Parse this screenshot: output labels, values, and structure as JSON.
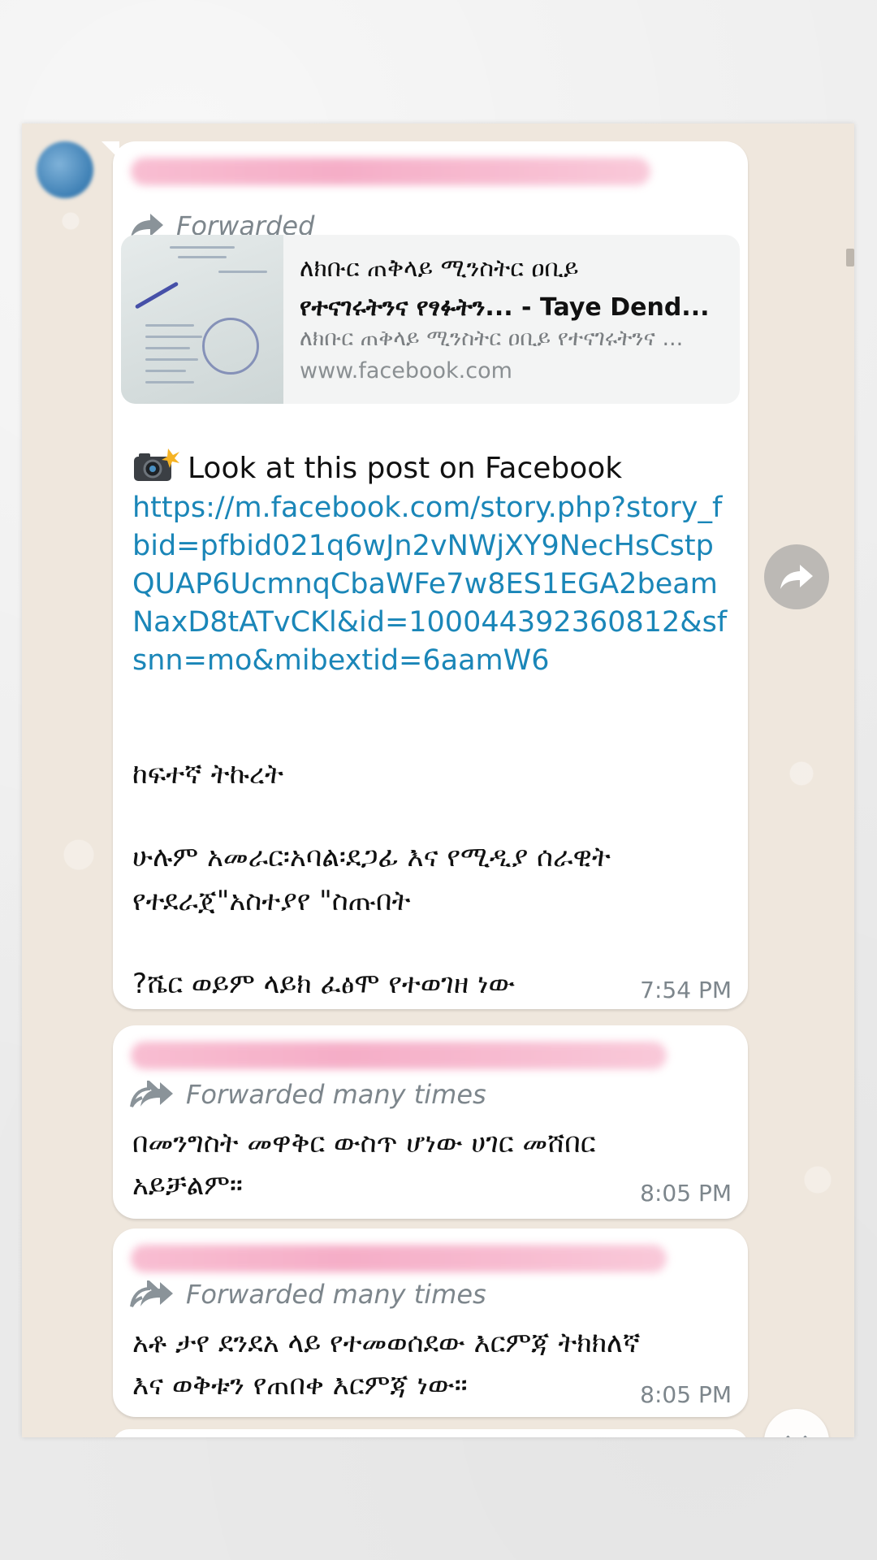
{
  "chat": {
    "messages": [
      {
        "forward_label": "Forwarded",
        "link_preview": {
          "title_line1": "ለክቡር ጠቅላይ ሚንስትር ዐቢይ",
          "title_line2": "የተናገሩትንና የፃፉትን... - Taye Dend...",
          "description": "ለክቡር ጠቅላይ ሚንስትር ዐቢይ የተናገሩትንና ...",
          "domain": "www.facebook.com"
        },
        "intro_text": "Look at this post on Facebook",
        "link_text": "https://m.facebook.com/story.php?story_fbid=pfbid021q6wJn2vNWjXY9NecHsCstpQUAP6UcmnqCbaWFe7w8ES1EGA2beamNaxD8tATvCKl&id=100044392360812&sfsnn=mo&mibextid=6aamW6",
        "line_a": "ከፍተኛ ትኩረት",
        "line_b1": "ሁሉም አመራር፡አባል፡ደጋፊ እና የሚዲያ ሰራዊት",
        "line_b2": "የተደራጀ\"አስተያየ \"ስጡበት",
        "line_c": "?ሼር ወይም ላይክ ፈፅሞ የተወገዘ ነው",
        "time": "7:54 PM"
      },
      {
        "forward_label": "Forwarded many times",
        "text_line1": "በመንግስት መዋቅር ውስጥ ሆነው ሀገር መሸበር",
        "text_line2": "አይቻልም።",
        "time": "8:05 PM"
      },
      {
        "forward_label": "Forwarded many times",
        "text_line1": "አቶ ታየ ደንደአ ላይ የተመወሰደው እርምጃ ትክክለኛ",
        "text_line2": "እና ወቅቱን የጠበቀ እርምጃ ነው።",
        "time": "8:05 PM"
      }
    ]
  },
  "icons": {
    "forward": "forward-arrow-icon",
    "forward_many": "double-forward-arrow-icon",
    "camera": "camera-flash-icon",
    "share": "share-icon",
    "scroll_down": "chevron-down-icon"
  },
  "colors": {
    "link": "#1a86b8",
    "meta": "#7d868c",
    "chat_bg": "#efe7dd",
    "bubble": "#ffffff"
  }
}
